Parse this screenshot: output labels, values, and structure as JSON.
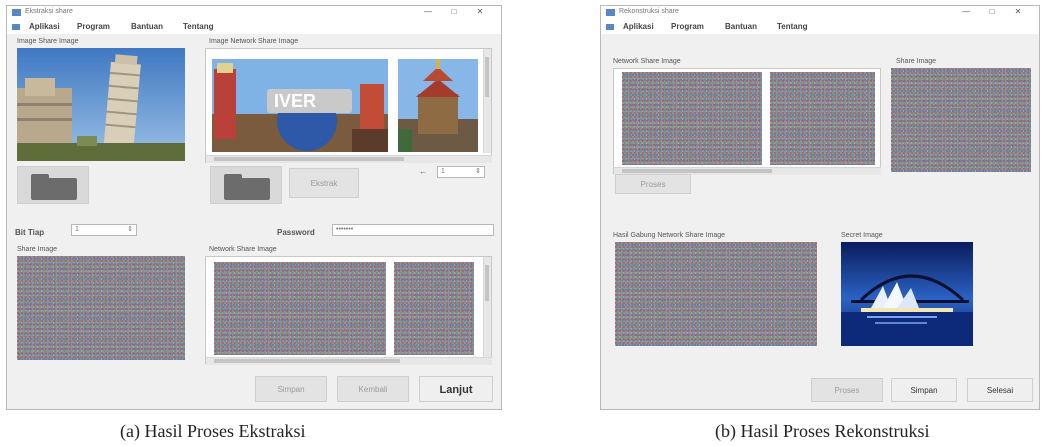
{
  "window_a": {
    "title": "Ekstraksi share",
    "menu": [
      "Aplikasi",
      "Program",
      "Bantuan",
      "Tentang"
    ],
    "host_image_label": "Image Share Image",
    "marked_image_label": "Image Network Share Image",
    "extract_button": "Ekstrak",
    "bits_label": "Bit Tiap",
    "bits_value": "1",
    "stepper_value": "1",
    "password_label": "Password",
    "password_value": "•••••••",
    "share_label": "Share Image",
    "network_label": "Network Share Image",
    "btn_save": "Simpan",
    "btn_back": "Kembali",
    "btn_next": "Lanjut"
  },
  "window_b": {
    "title": "Rekonstruksi share",
    "menu": [
      "Aplikasi",
      "Program",
      "Bantuan",
      "Tentang"
    ],
    "network_label": "Network Share Image",
    "share_label": "Share Image",
    "process_button": "Proses",
    "combined_label": "Hasil Gabung Network Share Image",
    "secret_label": "Secret Image",
    "btn_process": "Proses",
    "btn_save": "Simpan",
    "btn_exit": "Selesai"
  },
  "captions": {
    "a": "(a) Hasil Proses Ekstraksi",
    "b": "(b) Hasil Proses Rekonstruksi"
  }
}
